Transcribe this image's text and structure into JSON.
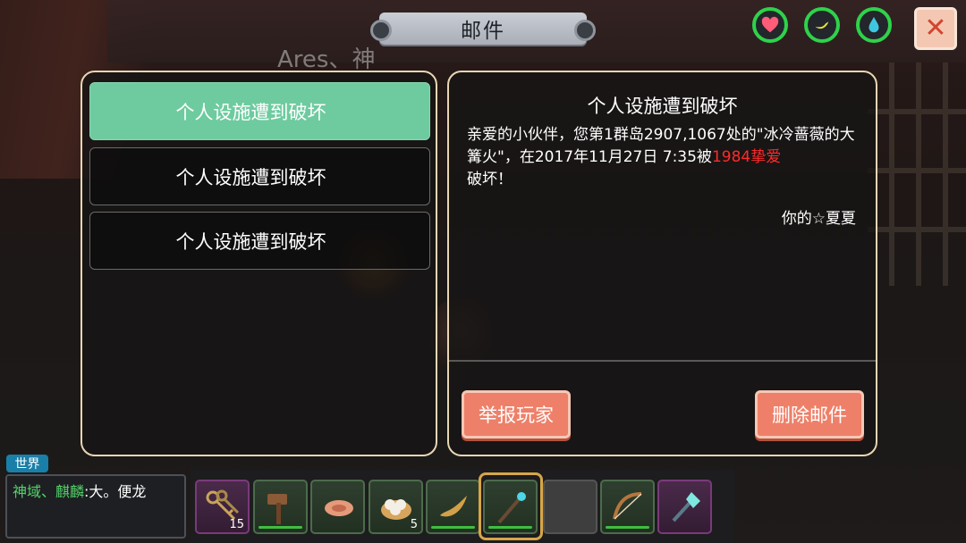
{
  "header": {
    "title": "邮件"
  },
  "background": {
    "player_name": "Ares、神"
  },
  "status_icons": [
    "heart-icon",
    "banana-icon",
    "water-drop-icon"
  ],
  "colors": {
    "accent_green": "#6ecb9f",
    "button_orange": "#ee8069",
    "highlight_red": "#ff2a2a",
    "status_ring": "#2fd24a"
  },
  "mail_list": [
    {
      "subject": "个人设施遭到破坏",
      "selected": true
    },
    {
      "subject": "个人设施遭到破坏",
      "selected": false
    },
    {
      "subject": "个人设施遭到破坏",
      "selected": false
    }
  ],
  "mail_detail": {
    "title": "个人设施遭到破坏",
    "body_prefix": "亲爱的小伙伴，您第1群岛2907,1067处的\"冰冷蔷薇的大篝火\"，在2017年11月27日 7:35被",
    "attacker": "1984挚爱",
    "body_suffix": "破坏！",
    "signature": "你的☆夏夏"
  },
  "actions": {
    "report": "举报玩家",
    "delete": "删除邮件"
  },
  "chat": {
    "channel": "世界",
    "speaker": "神域、麒麟",
    "separator": ":",
    "message": "大。便龙"
  },
  "hotbar": {
    "slots": [
      {
        "item": "keys-icon",
        "count": "15"
      },
      {
        "item": "hammer-icon",
        "count": ""
      },
      {
        "item": "meat-icon",
        "count": ""
      },
      {
        "item": "dumpling-basket-icon",
        "count": "5"
      },
      {
        "item": "horn-icon",
        "count": ""
      },
      {
        "item": "staff-icon",
        "count": ""
      },
      {
        "item": "empty",
        "count": ""
      },
      {
        "item": "bow-icon",
        "count": ""
      },
      {
        "item": "crystal-staff-icon",
        "count": ""
      }
    ],
    "selected_index": 5
  }
}
